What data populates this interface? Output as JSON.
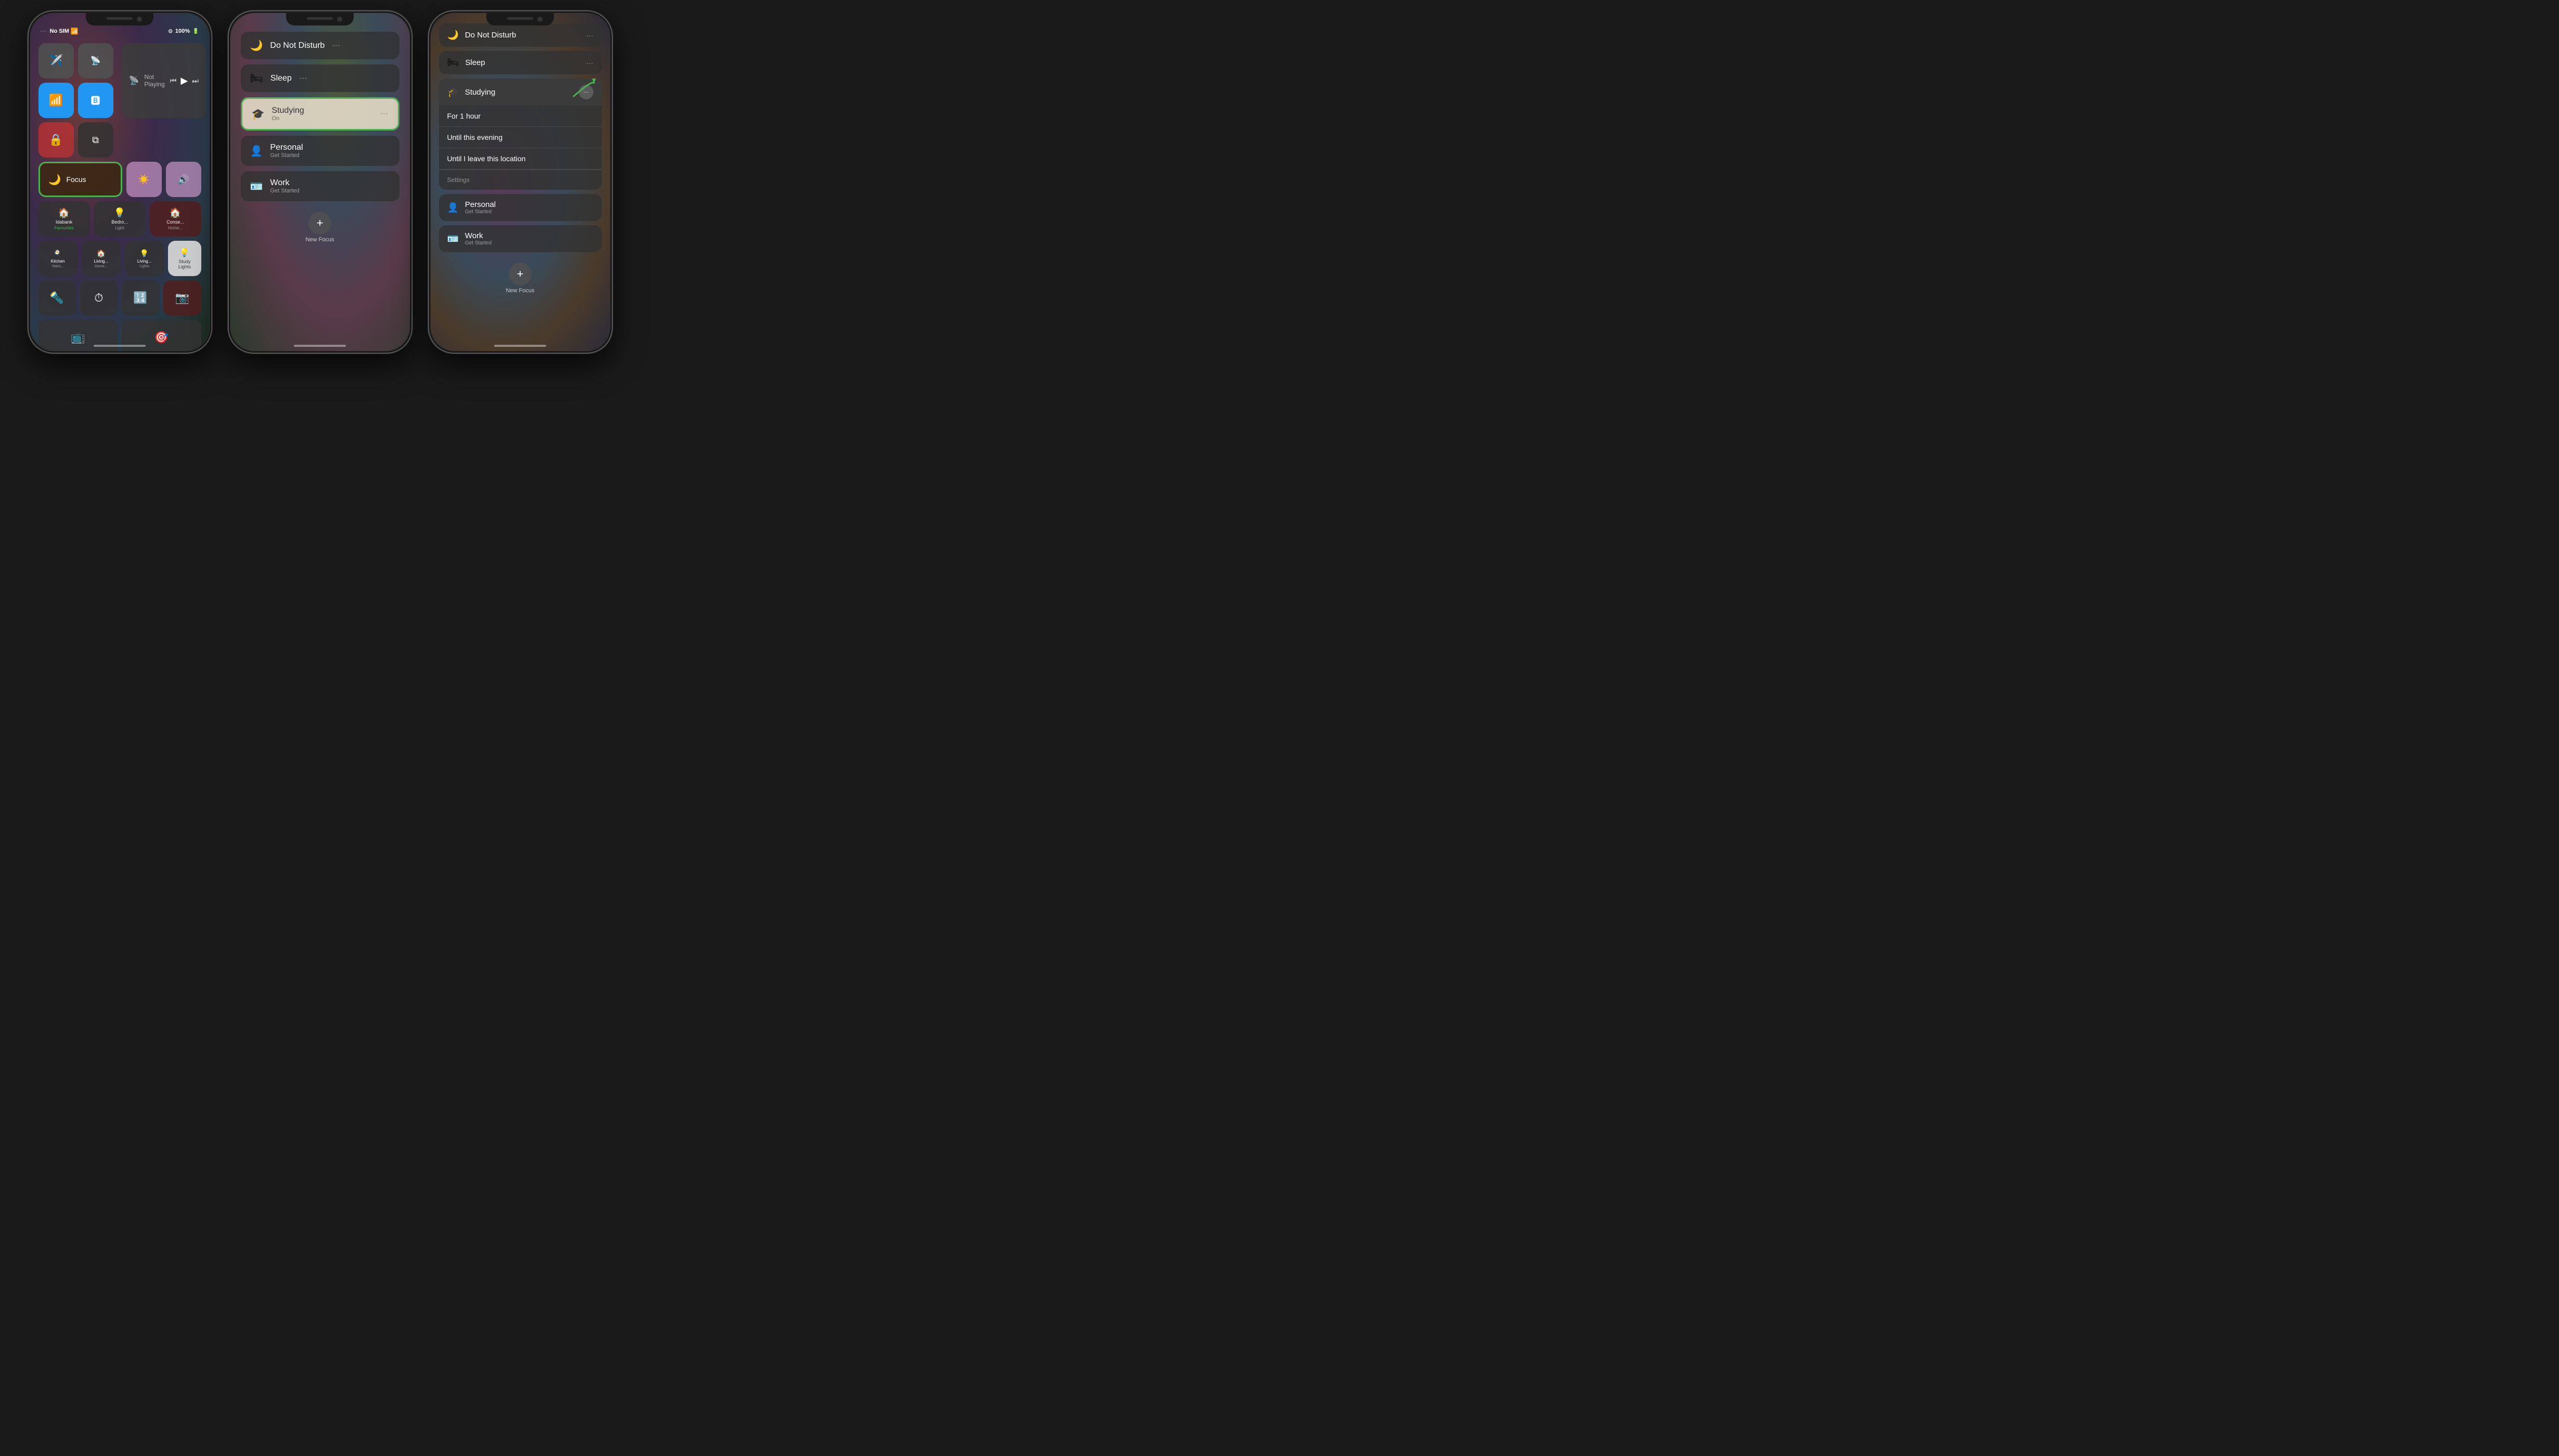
{
  "phone1": {
    "status": {
      "carrier": "No SIM",
      "time": "100%",
      "icons": [
        "location",
        "battery"
      ]
    },
    "media": {
      "title": "Not Playing",
      "airplay_icon": "📡"
    },
    "controls": {
      "airplane": "✈",
      "cellular": "📶",
      "wifi": "wifi",
      "bluetooth": "bluetooth",
      "rotation": "🔒",
      "mirroring": "⊞"
    },
    "focus": {
      "label": "Focus",
      "icon": "🌙"
    },
    "brightness": "☀",
    "volume": "🔊",
    "home_tiles": [
      {
        "icon": "🏠",
        "title": "Idabank",
        "sub": "Favourites"
      },
      {
        "icon": "💡",
        "title": "Bedro...",
        "sub": "Light"
      },
      {
        "icon": "🏠",
        "title": "Conse...",
        "sub": "Home..."
      }
    ],
    "home_tiles2": [
      {
        "icon": "🍳",
        "title": "Kitchen Naim..."
      },
      {
        "icon": "🏠",
        "title": "Living... Home..."
      },
      {
        "icon": "💡",
        "title": "Living... Lights"
      },
      {
        "icon": "💡",
        "title": "Study Lights",
        "white": true
      }
    ],
    "utils": [
      {
        "icon": "🔦"
      },
      {
        "icon": "⏱"
      },
      {
        "icon": "🔢"
      },
      {
        "icon": "📷"
      }
    ],
    "bottom": [
      {
        "icon": "📺"
      },
      {
        "icon": "🎯"
      }
    ]
  },
  "phone2": {
    "status_hidden": true,
    "focus_items": [
      {
        "icon": "🌙",
        "title": "Do Not Disturb",
        "dots": "···",
        "active": false
      },
      {
        "icon": "🛏",
        "title": "Sleep",
        "dots": "···",
        "active": false
      },
      {
        "icon": "🎓",
        "title": "Studying",
        "subtitle": "On",
        "dots": "···",
        "active": true
      },
      {
        "icon": "👤",
        "title": "Personal",
        "subtitle": "Get Started",
        "dots": "",
        "active": false
      },
      {
        "icon": "🪪",
        "title": "Work",
        "subtitle": "Get Started",
        "dots": "",
        "active": false
      }
    ],
    "new_focus": {
      "icon": "+",
      "label": "New Focus"
    }
  },
  "phone3": {
    "top_items": [
      {
        "icon": "🌙",
        "title": "Do Not Disturb",
        "dots": "···"
      },
      {
        "icon": "🛏",
        "title": "Sleep",
        "dots": "···"
      }
    ],
    "studying": {
      "icon": "🎓",
      "title": "Studying",
      "dots": "···",
      "duration_label": "For 1 hour",
      "options": [
        {
          "label": "For 1 hour",
          "key": "for_1_hour"
        },
        {
          "label": "Until this evening",
          "key": "until_evening"
        },
        {
          "label": "Until I leave this location",
          "key": "until_location"
        },
        {
          "label": "Settings",
          "key": "settings",
          "separator": true
        }
      ]
    },
    "bottom_items": [
      {
        "icon": "👤",
        "title": "Personal",
        "subtitle": "Get Started"
      },
      {
        "icon": "🪪",
        "title": "Work",
        "subtitle": "Get Started"
      }
    ],
    "new_focus": {
      "icon": "+",
      "label": "New Focus"
    },
    "arrow": "➜"
  }
}
